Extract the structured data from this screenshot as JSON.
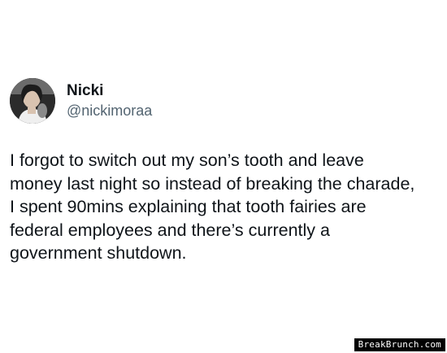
{
  "tweet": {
    "author": {
      "display_name": "Nicki",
      "handle": "@nickimoraa",
      "avatar_icon": "profile-photo"
    },
    "lines": [
      "I forgot to switch out my son’s tooth and leave",
      "money last night so instead of breaking the charade,",
      "I spent 90mins explaining that tooth fairies are",
      "federal employees and there’s currently a",
      "government shutdown."
    ]
  },
  "watermark": {
    "text": "BreakBrunch.com"
  },
  "colors": {
    "background": "#ffffff",
    "text": "#0f1419",
    "handle": "#536471",
    "watermark_bg": "#000000"
  }
}
